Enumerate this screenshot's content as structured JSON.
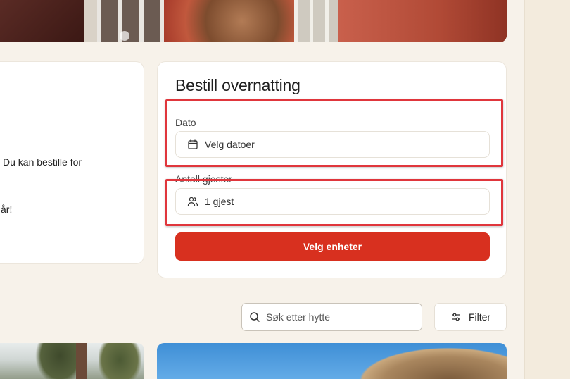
{
  "info_card": {
    "line1": "Du kan bestille for",
    "line2": "år!"
  },
  "booking": {
    "title": "Bestill overnatting",
    "date_label": "Dato",
    "date_value": "Velg datoer",
    "guests_label": "Antall gjester",
    "guests_value": "1 gjest",
    "submit_label": "Velg enheter"
  },
  "search": {
    "placeholder": "Søk etter hytte",
    "filter_label": "Filter"
  },
  "icons": {
    "date": "calendar-icon",
    "guests": "users-icon",
    "search": "search-icon",
    "filter": "sliders-icon"
  },
  "colors": {
    "accent": "#d8301f",
    "highlight": "#e0363c",
    "background": "#f7f2ea"
  }
}
